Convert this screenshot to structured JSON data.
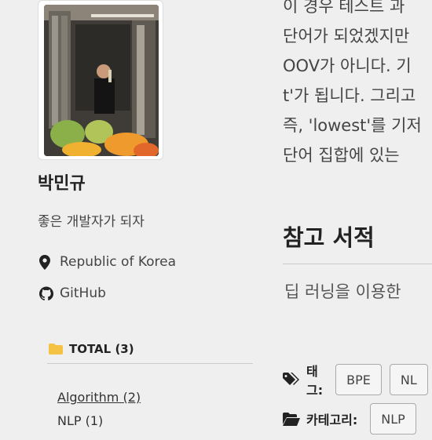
{
  "profile": {
    "name": "박민규",
    "bio": "좋은 개발자가 되자",
    "location": "Republic of Korea",
    "github_label": "GitHub"
  },
  "sidebar": {
    "total_label": "TOTAL (3)",
    "categories": [
      {
        "label": "Algorithm (2)"
      },
      {
        "label": "NLP (1)"
      }
    ]
  },
  "article": {
    "lines": [
      "이 경우 테스트 과",
      "단어가 되었겠지만",
      "OOV가 아니다. 기",
      "t'가 됩니다. 그리고",
      "즉, 'lowest'를 기저",
      "단어 집합에 있는"
    ],
    "references_heading": "참고 서적",
    "reference_text": "딥 러닝을 이용한"
  },
  "footer": {
    "tags_label": "태그:",
    "tags": [
      "BPE",
      "NL"
    ],
    "categories_label": "카테고리:",
    "categories": [
      "NLP"
    ]
  },
  "colors": {
    "background": "#efefef",
    "folder": "#f6c244",
    "text_dark": "#222222"
  }
}
